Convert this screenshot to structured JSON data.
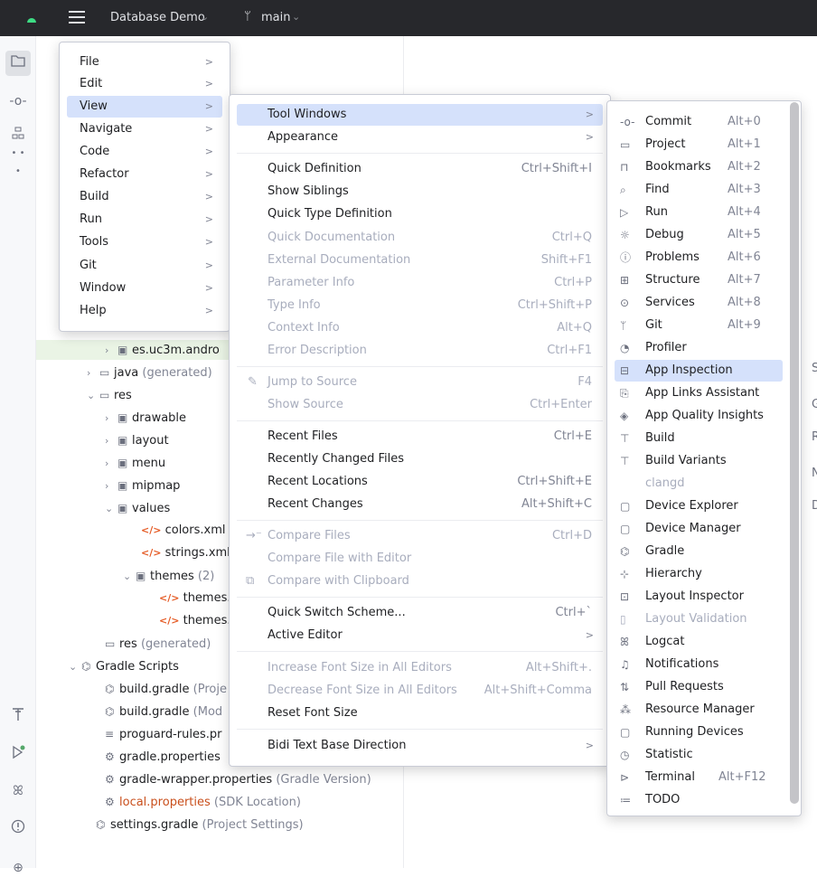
{
  "titlebar": {
    "project": "Database Demo",
    "branch": "main"
  },
  "toolstrip": {
    "top_icons": [
      "folder-icon",
      "commit-icon",
      "structure-icon",
      "more-icon"
    ],
    "bottom_icons": [
      "build-icon",
      "run-icon",
      "logcat-icon",
      "problems-icon",
      "git-icon"
    ],
    "more_label": "• • •"
  },
  "tree": {
    "rows": [
      {
        "label": "es.uc3m.andro",
        "suffix": ""
      },
      {
        "label": "java",
        "suffix": " (generated)"
      },
      {
        "label": "res",
        "suffix": ""
      },
      {
        "label": "drawable",
        "suffix": ""
      },
      {
        "label": "layout",
        "suffix": ""
      },
      {
        "label": "menu",
        "suffix": ""
      },
      {
        "label": "mipmap",
        "suffix": ""
      },
      {
        "label": "values",
        "suffix": ""
      },
      {
        "label": "colors.xml",
        "suffix": ""
      },
      {
        "label": "strings.xml",
        "suffix": ""
      },
      {
        "label": "themes",
        "suffix": " (2)"
      },
      {
        "label": "themes.:",
        "suffix": ""
      },
      {
        "label": "themes.:",
        "suffix": ""
      },
      {
        "label": "res",
        "suffix": " (generated)"
      },
      {
        "label": "Gradle Scripts",
        "suffix": ""
      },
      {
        "label": "build.gradle",
        "suffix": " (Proje"
      },
      {
        "label": "build.gradle",
        "suffix": " (Mod"
      },
      {
        "label": "proguard-rules.pr",
        "suffix": ""
      },
      {
        "label": "gradle.properties",
        "suffix": ""
      },
      {
        "label": "gradle-wrapper.properties",
        "suffix": " (Gradle Version)"
      },
      {
        "label": "local.properties",
        "suffix": " (SDK Location)"
      },
      {
        "label": "settings.gradle",
        "suffix": " (Project Settings)"
      }
    ]
  },
  "rightpane_letters": [
    "S",
    "G",
    "R",
    "N",
    "D"
  ],
  "main_menu": {
    "items": [
      "File",
      "Edit",
      "View",
      "Navigate",
      "Code",
      "Refactor",
      "Build",
      "Run",
      "Tools",
      "Git",
      "Window",
      "Help"
    ],
    "submenu_arrow": ">"
  },
  "view_menu": {
    "items": [
      {
        "label": "Tool Windows",
        "shortcut": "",
        "sub": ">"
      },
      {
        "label": "Appearance",
        "shortcut": "",
        "sub": ">"
      },
      {
        "label": "Quick Definition",
        "shortcut": "Ctrl+Shift+I",
        "sub": ""
      },
      {
        "label": "Show Siblings",
        "shortcut": "",
        "sub": ""
      },
      {
        "label": "Quick Type Definition",
        "shortcut": "",
        "sub": ""
      },
      {
        "label": "Quick Documentation",
        "shortcut": "Ctrl+Q",
        "sub": ""
      },
      {
        "label": "External Documentation",
        "shortcut": "Shift+F1",
        "sub": ""
      },
      {
        "label": "Parameter Info",
        "shortcut": "Ctrl+P",
        "sub": ""
      },
      {
        "label": "Type Info",
        "shortcut": "Ctrl+Shift+P",
        "sub": ""
      },
      {
        "label": "Context Info",
        "shortcut": "Alt+Q",
        "sub": ""
      },
      {
        "label": "Error Description",
        "shortcut": "Ctrl+F1",
        "sub": ""
      },
      {
        "label": "Jump to Source",
        "shortcut": "F4",
        "sub": ""
      },
      {
        "label": "Show Source",
        "shortcut": "Ctrl+Enter",
        "sub": ""
      },
      {
        "label": "Recent Files",
        "shortcut": "Ctrl+E",
        "sub": ""
      },
      {
        "label": "Recently Changed Files",
        "shortcut": "",
        "sub": ""
      },
      {
        "label": "Recent Locations",
        "shortcut": "Ctrl+Shift+E",
        "sub": ""
      },
      {
        "label": "Recent Changes",
        "shortcut": "Alt+Shift+C",
        "sub": ""
      },
      {
        "label": "Compare Files",
        "shortcut": "Ctrl+D",
        "sub": ""
      },
      {
        "label": "Compare File with Editor",
        "shortcut": "",
        "sub": ""
      },
      {
        "label": "Compare with Clipboard",
        "shortcut": "",
        "sub": ""
      },
      {
        "label": "Quick Switch Scheme...",
        "shortcut": "Ctrl+`",
        "sub": ""
      },
      {
        "label": "Active Editor",
        "shortcut": "",
        "sub": ">"
      },
      {
        "label": "Increase Font Size in All Editors",
        "shortcut": "Alt+Shift+.",
        "sub": ""
      },
      {
        "label": "Decrease Font Size in All Editors",
        "shortcut": "Alt+Shift+Comma",
        "sub": ""
      },
      {
        "label": "Reset Font Size",
        "shortcut": "",
        "sub": ""
      },
      {
        "label": "Bidi Text Base Direction",
        "shortcut": "",
        "sub": ">"
      }
    ]
  },
  "tool_windows_menu": {
    "items": [
      {
        "label": "Commit",
        "shortcut": "Alt+0",
        "icon": "commit-icon"
      },
      {
        "label": "Project",
        "shortcut": "Alt+1",
        "icon": "folder-icon"
      },
      {
        "label": "Bookmarks",
        "shortcut": "Alt+2",
        "icon": "bookmark-icon"
      },
      {
        "label": "Find",
        "shortcut": "Alt+3",
        "icon": "search-icon"
      },
      {
        "label": "Run",
        "shortcut": "Alt+4",
        "icon": "run-icon"
      },
      {
        "label": "Debug",
        "shortcut": "Alt+5",
        "icon": "bug-icon"
      },
      {
        "label": "Problems",
        "shortcut": "Alt+6",
        "icon": "problems-icon"
      },
      {
        "label": "Structure",
        "shortcut": "Alt+7",
        "icon": "structure-icon"
      },
      {
        "label": "Services",
        "shortcut": "Alt+8",
        "icon": "services-icon"
      },
      {
        "label": "Git",
        "shortcut": "Alt+9",
        "icon": "git-icon"
      },
      {
        "label": "Profiler",
        "shortcut": "",
        "icon": "profiler-icon"
      },
      {
        "label": "App Inspection",
        "shortcut": "",
        "icon": "inspection-icon"
      },
      {
        "label": "App Links Assistant",
        "shortcut": "",
        "icon": "links-icon"
      },
      {
        "label": "App Quality Insights",
        "shortcut": "",
        "icon": "quality-icon"
      },
      {
        "label": "Build",
        "shortcut": "",
        "icon": "build-icon"
      },
      {
        "label": "Build Variants",
        "shortcut": "",
        "icon": "variants-icon"
      },
      {
        "label": "clangd",
        "shortcut": "",
        "icon": ""
      },
      {
        "label": "Device Explorer",
        "shortcut": "",
        "icon": "device-explorer-icon"
      },
      {
        "label": "Device Manager",
        "shortcut": "",
        "icon": "device-manager-icon"
      },
      {
        "label": "Gradle",
        "shortcut": "",
        "icon": "gradle-icon"
      },
      {
        "label": "Hierarchy",
        "shortcut": "",
        "icon": "hierarchy-icon"
      },
      {
        "label": "Layout Inspector",
        "shortcut": "",
        "icon": "layout-inspector-icon"
      },
      {
        "label": "Layout Validation",
        "shortcut": "",
        "icon": "layout-validation-icon"
      },
      {
        "label": "Logcat",
        "shortcut": "",
        "icon": "logcat-icon"
      },
      {
        "label": "Notifications",
        "shortcut": "",
        "icon": "notifications-icon"
      },
      {
        "label": "Pull Requests",
        "shortcut": "",
        "icon": "pull-requests-icon"
      },
      {
        "label": "Resource Manager",
        "shortcut": "",
        "icon": "resource-icon"
      },
      {
        "label": "Running Devices",
        "shortcut": "",
        "icon": "running-devices-icon"
      },
      {
        "label": "Statistic",
        "shortcut": "",
        "icon": "statistic-icon"
      },
      {
        "label": "Terminal",
        "shortcut": "Alt+F12",
        "icon": "terminal-icon"
      },
      {
        "label": "TODO",
        "shortcut": "",
        "icon": "todo-icon"
      }
    ]
  },
  "colors": {
    "titlebar": "#27282c",
    "selection": "#d5e1fb",
    "tree_selection": "#eaf4e5",
    "accent_green": "#55a76a"
  }
}
